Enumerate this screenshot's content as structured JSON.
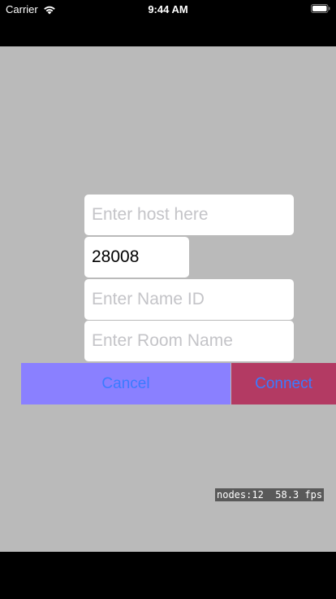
{
  "status_bar": {
    "carrier": "Carrier",
    "time": "9:44 AM",
    "wifi_icon": "wifi-icon",
    "battery_icon": "battery-icon"
  },
  "form": {
    "host": {
      "value": "",
      "placeholder": "Enter host here"
    },
    "port": {
      "value": "28008",
      "placeholder": ""
    },
    "name": {
      "value": "",
      "placeholder": "Enter Name ID"
    },
    "room": {
      "value": "",
      "placeholder": "Enter Room Name"
    }
  },
  "buttons": {
    "cancel_label": "Cancel",
    "connect_label": "Connect"
  },
  "debug": {
    "stats": "nodes:12  58.3 fps"
  },
  "colors": {
    "background": "#bababa",
    "cancel_bg": "#8a80ff",
    "connect_bg": "#b33a63",
    "button_text": "#3b7bff"
  }
}
